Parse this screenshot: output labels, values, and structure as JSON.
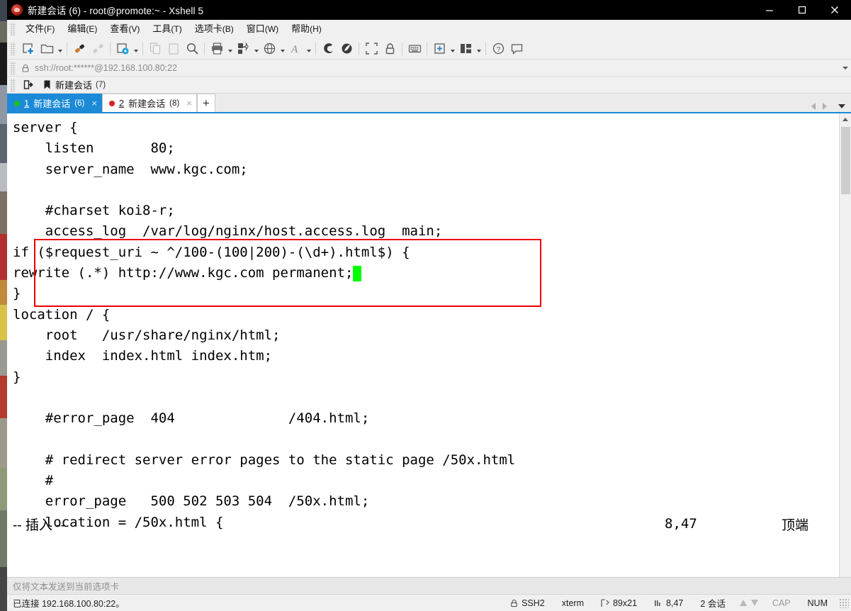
{
  "window": {
    "title": "新建会话 (6) - root@promote:~ - Xshell 5",
    "minimize_label": "最小化",
    "maximize_label": "最大化",
    "close_label": "关闭"
  },
  "menubar": {
    "items": [
      {
        "label": "文件",
        "mnemonic": "(F)"
      },
      {
        "label": "编辑",
        "mnemonic": "(E)"
      },
      {
        "label": "查看",
        "mnemonic": "(V)"
      },
      {
        "label": "工具",
        "mnemonic": "(T)"
      },
      {
        "label": "选项卡",
        "mnemonic": "(B)"
      },
      {
        "label": "窗口",
        "mnemonic": "(W)"
      },
      {
        "label": "帮助",
        "mnemonic": "(H)"
      }
    ]
  },
  "toolbar": {
    "buttons": [
      "new-session-icon",
      "open-folder-icon",
      "connect-icon",
      "disconnect-icon",
      "session-properties-icon",
      "copy-icon",
      "paste-icon",
      "find-icon",
      "print-icon",
      "transfer-icon",
      "browser-icon",
      "font-icon",
      "xshell-icon",
      "xftp-icon",
      "fullscreen-icon",
      "lock-icon",
      "keyboard-icon",
      "add-pane-icon",
      "layout-icon",
      "help-icon",
      "feedback-icon"
    ]
  },
  "address": {
    "value": "ssh://root:******@192.168.100.80:22",
    "lock_icon": "lock-icon"
  },
  "bookmarks": {
    "items": [
      {
        "icon": "open-session-icon",
        "label": "",
        "count": ""
      },
      {
        "icon": "bookmark-icon",
        "label": "新建会话",
        "count": "(7)"
      }
    ]
  },
  "tabs": {
    "items": [
      {
        "num": "1",
        "label": "新建会话",
        "count": "(6)",
        "status_color": "#17c217",
        "active": true
      },
      {
        "num": "2",
        "label": "新建会话",
        "count": "(8)",
        "status_color": "#e02020",
        "active": false
      }
    ],
    "add_label": "+"
  },
  "terminal": {
    "lines": [
      "server {",
      "    listen       80;",
      "    server_name  www.kgc.com;",
      "",
      "    #charset koi8-r;",
      "    access_log  /var/log/nginx/host.access.log  main;",
      "if ($request_uri ~ ^/100-(100|200)-(\\d+).html$) {",
      "rewrite (.*) http://www.kgc.com permanent;",
      "}",
      "location / {",
      "    root   /usr/share/nginx/html;",
      "    index  index.html index.htm;",
      "}",
      "",
      "    #error_page  404              /404.html;",
      "",
      "    # redirect server error pages to the static page /50x.html",
      "    #",
      "    error_page   500 502 503 504  /50x.html;",
      "    location = /50x.html {"
    ],
    "cursor_char": "█",
    "highlight_color": "#ee0000",
    "cursor_color": "#00ff00",
    "vim_mode": "-- 插入 --",
    "vim_position": "8,47",
    "vim_scroll": "顶端"
  },
  "command_input": {
    "placeholder": "仅将文本发送到当前选项卡"
  },
  "statusbar": {
    "connection": "已连接 192.168.100.80:22。",
    "protocol": "SSH2",
    "terminal_type": "xterm",
    "size": "89x21",
    "cursor": "8,47",
    "sessions": "2 会话",
    "caps": "CAP",
    "num": "NUM"
  }
}
